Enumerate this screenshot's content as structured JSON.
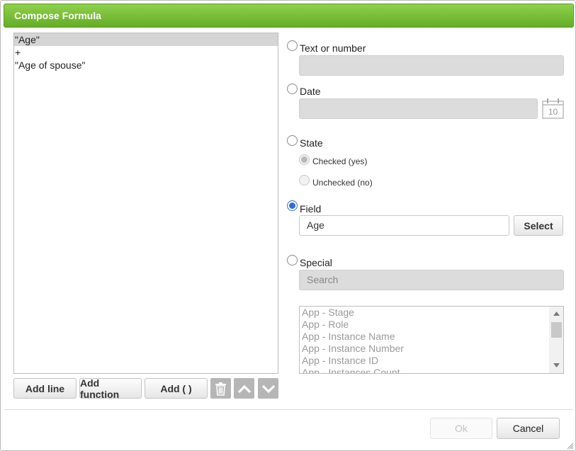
{
  "dialog": {
    "title": "Compose Formula"
  },
  "formula": {
    "lines": [
      "\"Age\"",
      "+",
      "\"Age of spouse\""
    ],
    "selected_index": 0
  },
  "toolbar": {
    "add_line": "Add line",
    "add_function": "Add function",
    "add_parens": "Add ( )",
    "icons": [
      "trash-icon",
      "chevron-up-icon",
      "chevron-down-icon"
    ]
  },
  "options": {
    "text_or_number": {
      "label": "Text or number",
      "value": ""
    },
    "date": {
      "label": "Date",
      "value": "",
      "calendar_day": "10"
    },
    "state": {
      "label": "State",
      "checked_label": "Checked (yes)",
      "unchecked_label": "Unchecked (no)"
    },
    "field": {
      "label": "Field",
      "value": "Age",
      "select_label": "Select"
    },
    "special": {
      "label": "Special",
      "search_placeholder": "Search",
      "items": [
        "App - Stage",
        "App - Role",
        "App - Instance Name",
        "App - Instance Number",
        "App - Instance ID",
        "App - Instances Count"
      ]
    },
    "selected": "field"
  },
  "footer": {
    "ok_label": "Ok",
    "cancel_label": "Cancel"
  },
  "colors": {
    "title_green": "#6cb52e",
    "radio_blue": "#2f6ed8",
    "icon_button_gray": "#b6b6b6"
  }
}
